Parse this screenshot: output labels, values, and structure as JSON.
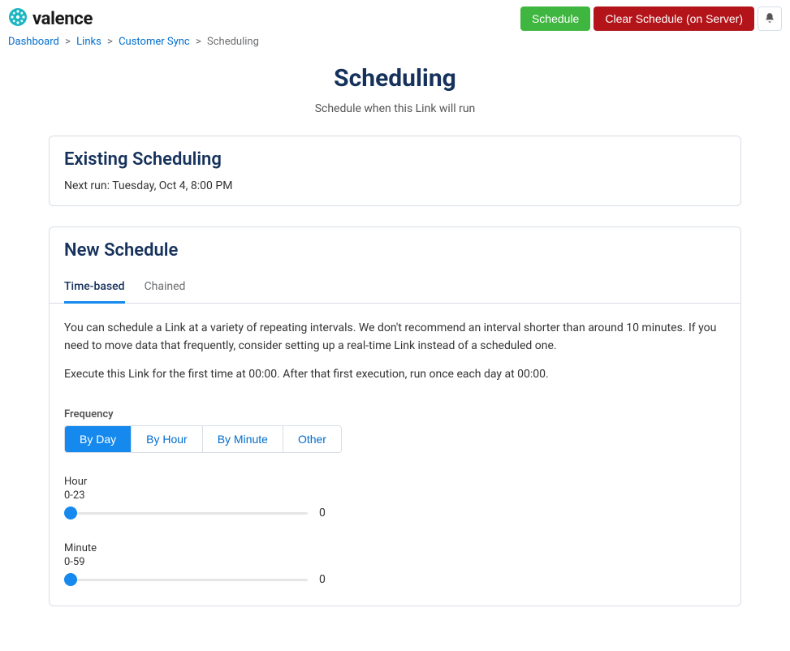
{
  "brand": {
    "name": "valence"
  },
  "header": {
    "schedule_label": "Schedule",
    "clear_label": "Clear Schedule (on Server)"
  },
  "breadcrumb": {
    "items": [
      "Dashboard",
      "Links",
      "Customer Sync"
    ],
    "current": "Scheduling"
  },
  "page": {
    "title": "Scheduling",
    "subtitle": "Schedule when this Link will run"
  },
  "existing": {
    "title": "Existing Scheduling",
    "next_run": "Next run: Tuesday, Oct 4, 8:00 PM"
  },
  "new_schedule": {
    "title": "New Schedule",
    "tabs": {
      "time_based": "Time-based",
      "chained": "Chained"
    },
    "help": "You can schedule a Link at a variety of repeating intervals. We don't recommend an interval shorter than around 10 minutes. If you need to move data that frequently, consider setting up a real-time Link instead of a scheduled one.",
    "exec_summary": "Execute this Link for the first time at 00:00. After that first execution, run once each day at 00:00.",
    "frequency": {
      "label": "Frequency",
      "options": {
        "by_day": "By Day",
        "by_hour": "By Hour",
        "by_minute": "By Minute",
        "other": "Other"
      }
    },
    "sliders": {
      "hour": {
        "label": "Hour",
        "range": "0-23",
        "value": "0"
      },
      "minute": {
        "label": "Minute",
        "range": "0-59",
        "value": "0"
      }
    }
  }
}
